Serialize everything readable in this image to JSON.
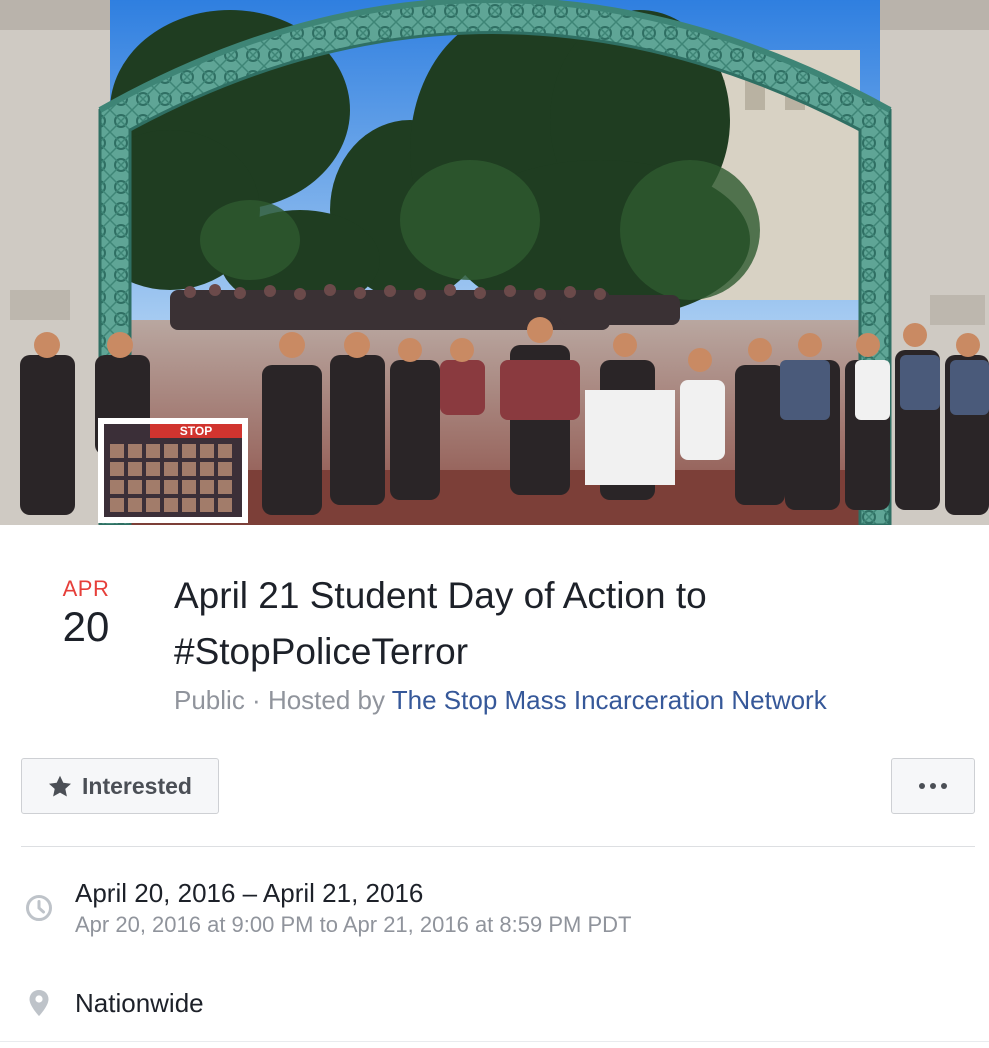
{
  "event": {
    "date": {
      "month": "APR",
      "day": "20"
    },
    "title_line1": "April 21 Student Day of Action to",
    "title_line2": "#StopPoliceTerror",
    "privacy": "Public",
    "separator": " · ",
    "hosted_prefix": "Hosted by ",
    "host": "The Stop Mass Incarceration Network"
  },
  "cover_photo": {
    "sign_text": "STOP"
  },
  "actions": {
    "interested_label": "Interested",
    "interested_icon": "star-icon",
    "more_icon": "more-options-icon"
  },
  "details": {
    "date_range": "April 20, 2016 – April 21, 2016",
    "time_range": "Apr 20, 2016 at 9:00 PM to Apr 21, 2016 at 8:59 PM PDT",
    "time_icon": "clock-icon",
    "location": "Nationwide",
    "location_icon": "map-pin-icon"
  },
  "colors": {
    "month_red": "#e63f3a",
    "link_blue": "#365899",
    "muted_gray": "#90949c",
    "text_dark": "#1d2129",
    "gate_green": "#5fa596"
  }
}
